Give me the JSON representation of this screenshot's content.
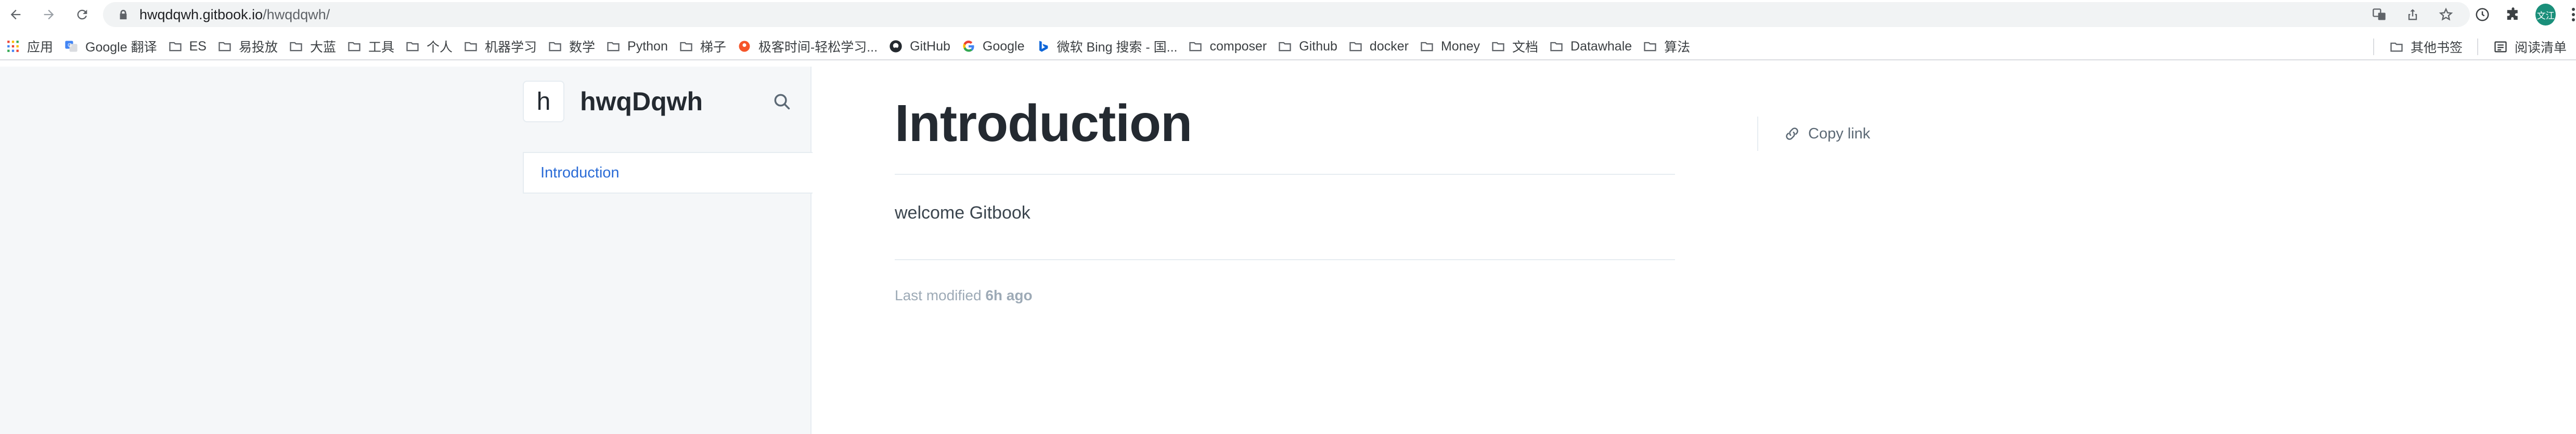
{
  "browser": {
    "url_host": "hwqdqwh.gitbook.io",
    "url_path": "/hwqdqwh/",
    "avatar_text": "文江"
  },
  "bookmarks": {
    "items": [
      {
        "label": "应用",
        "icon": "apps-grid-icon"
      },
      {
        "label": "Google 翻译",
        "icon": "google-translate-icon"
      },
      {
        "label": "ES",
        "icon": "folder-icon"
      },
      {
        "label": "易投放",
        "icon": "folder-icon"
      },
      {
        "label": "大蓝",
        "icon": "folder-icon"
      },
      {
        "label": "工具",
        "icon": "folder-icon"
      },
      {
        "label": "个人",
        "icon": "folder-icon"
      },
      {
        "label": "机器学习",
        "icon": "folder-icon"
      },
      {
        "label": "数学",
        "icon": "folder-icon"
      },
      {
        "label": "Python",
        "icon": "folder-icon"
      },
      {
        "label": "梯子",
        "icon": "folder-icon"
      },
      {
        "label": "极客时间-轻松学习...",
        "icon": "geektime-icon"
      },
      {
        "label": "GitHub",
        "icon": "github-icon"
      },
      {
        "label": "Google",
        "icon": "google-icon"
      },
      {
        "label": "微软 Bing 搜索 - 国...",
        "icon": "bing-icon"
      },
      {
        "label": "composer",
        "icon": "folder-icon"
      },
      {
        "label": "Github",
        "icon": "folder-icon"
      },
      {
        "label": "docker",
        "icon": "folder-icon"
      },
      {
        "label": "Money",
        "icon": "folder-icon"
      },
      {
        "label": "文档",
        "icon": "folder-icon"
      },
      {
        "label": "Datawhale",
        "icon": "folder-icon"
      },
      {
        "label": "算法",
        "icon": "folder-icon"
      }
    ],
    "other_bookmarks": "其他书签",
    "reading_list": "阅读清单"
  },
  "sidebar": {
    "logo_letter": "h",
    "space_title": "hwqDqwh",
    "toc_item": "Introduction"
  },
  "main": {
    "title": "Introduction",
    "body": "welcome Gitbook",
    "last_modified_prefix": "Last modified ",
    "last_modified_value": "6h ago",
    "copy_link": "Copy link"
  },
  "colors": {
    "link_blue": "#2a6bd6",
    "sidebar_bg": "#f5f7f9",
    "title": "#242a31",
    "muted": "#9daab6"
  }
}
